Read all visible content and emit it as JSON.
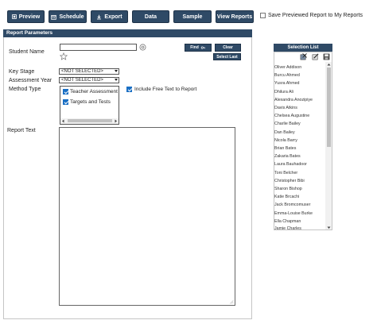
{
  "toolbar": {
    "preview": "Preview",
    "schedule": "Schedule",
    "export": "Export",
    "data": "Data",
    "sample": "Sample",
    "view_reports": "View Reports",
    "save_previewed_label": "Save Previewed Report to My Reports"
  },
  "panel": {
    "title": "Report Parameters",
    "student_name_label": "Student Name",
    "student_name_value": "",
    "find_label": "Find",
    "clear_label": "Clear",
    "select_last_label": "Select Last",
    "key_stage_label": "Key Stage",
    "key_stage_value": "<NOT SELECTED>",
    "assessment_year_label": "Assessment Year",
    "assessment_year_value": "<NOT SELECTED>",
    "method_type_label": "Method Type",
    "method_types": [
      {
        "label": "Teacher Assessment",
        "checked": true
      },
      {
        "label": "Targets and Tests",
        "checked": true
      }
    ],
    "include_free_text_label": "Include Free Text to Report",
    "report_text_label": "Report Text",
    "report_text_value": ""
  },
  "selection_list": {
    "title": "Selection List",
    "items": [
      "Oliver Addison",
      "Burcu Ahmed",
      "Yusra Ahmed",
      "Dhilura Ali",
      "Alexandra Anozipiye",
      "Davis Atkins",
      "Chelsea Augustine",
      "Charlie Bailey",
      "Dan Bailey",
      "Nicola Barry",
      "Brian Bates",
      "Zakaria Bates",
      "Laura Bauhadoor",
      "Toni Belcher",
      "Christopher Bibi",
      "Sharon Bishop",
      "Katie Brcachi",
      "Jack Bromcomuser",
      "Emma-Louise Burke",
      "Ella Chapman",
      "Jamie Charles"
    ]
  },
  "colors": {
    "accent": "#2f4a66",
    "checkbox": "#1a6fc4"
  }
}
